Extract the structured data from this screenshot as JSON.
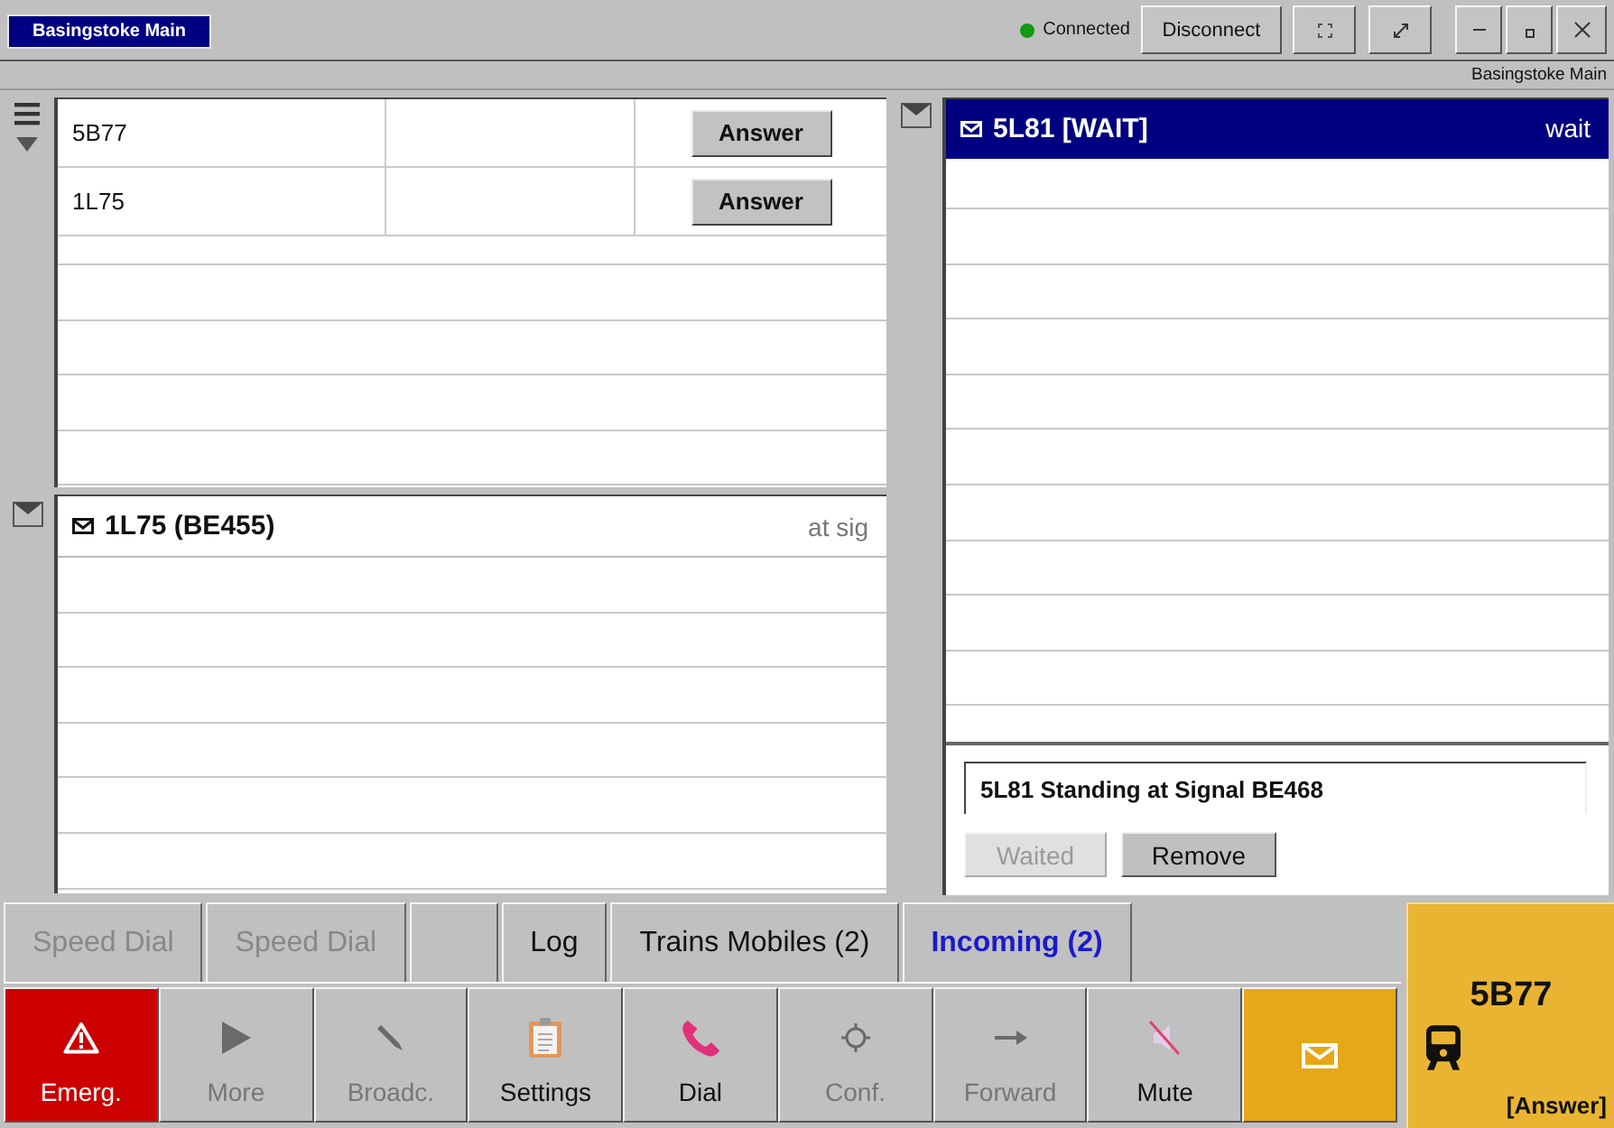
{
  "header": {
    "station": "Basingstoke Main",
    "connection": {
      "label": "Connected",
      "connected": true
    },
    "disconnect": "Disconnect"
  },
  "location": "Basingstoke Main",
  "left_panel": {
    "calls": [
      {
        "train": "5B77",
        "action": "Answer"
      },
      {
        "train": "1L75",
        "action": "Answer"
      }
    ],
    "message": {
      "title": "1L75 (BE455)",
      "status": "at sig",
      "selected": false
    }
  },
  "right_panel": {
    "message": {
      "title": "5L81 [WAIT]",
      "status": "wait",
      "selected": true
    },
    "note": "5L81 Standing at Signal BE468",
    "buttons": [
      {
        "label": "Waited",
        "disabled": true
      },
      {
        "label": "Remove",
        "disabled": false
      }
    ]
  },
  "tabs": [
    {
      "kind": "text",
      "label": "Speed Dial",
      "disabled": true,
      "selected": false
    },
    {
      "kind": "text",
      "label": "Speed Dial",
      "disabled": true,
      "selected": false
    },
    {
      "kind": "blank"
    },
    {
      "kind": "text",
      "label": "Log",
      "disabled": false,
      "selected": false
    },
    {
      "kind": "text",
      "label": "Trains Mobiles (2)",
      "disabled": false,
      "selected": false
    },
    {
      "kind": "text",
      "label": "Incoming (2)",
      "disabled": false,
      "selected": true
    }
  ],
  "actions": [
    {
      "label": "Emerg.",
      "kind": "emergency",
      "disabled": false
    },
    {
      "label": "More",
      "kind": "more",
      "disabled": true
    },
    {
      "label": "Broadc.",
      "kind": "broadcast",
      "disabled": true
    },
    {
      "label": "Settings",
      "kind": "settings",
      "disabled": false
    },
    {
      "label": "Dial",
      "kind": "dial",
      "disabled": false
    },
    {
      "label": "Conf.",
      "kind": "conference",
      "disabled": true
    },
    {
      "label": "Forward",
      "kind": "forward",
      "disabled": true
    },
    {
      "label": "Mute",
      "kind": "mute",
      "disabled": false
    },
    {
      "kind": "message"
    }
  ],
  "current_call": {
    "train": "5B77",
    "action": "[Answer]"
  }
}
